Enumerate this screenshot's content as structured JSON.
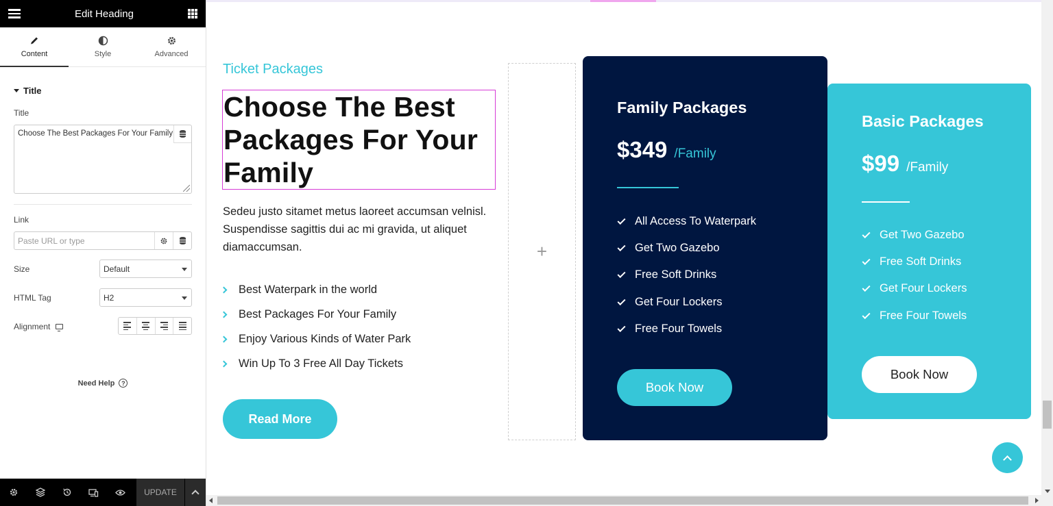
{
  "panel": {
    "header_title": "Edit Heading",
    "tabs": [
      {
        "label": "Content",
        "icon": "pencil-icon"
      },
      {
        "label": "Style",
        "icon": "half-circle-icon"
      },
      {
        "label": "Advanced",
        "icon": "gear-icon"
      }
    ],
    "active_tab": "Content",
    "section_title": "Title",
    "title_label": "Title",
    "title_value": "Choose The Best Packages For Your Family",
    "link_label": "Link",
    "link_placeholder": "Paste URL or type",
    "size_label": "Size",
    "size_value": "Default",
    "html_tag_label": "HTML Tag",
    "html_tag_value": "H2",
    "alignment_label": "Alignment",
    "need_help": "Need Help",
    "footer": {
      "update_label": "UPDATE"
    }
  },
  "page": {
    "subtitle": "Ticket Packages",
    "heading_lines": [
      "Choose The Best",
      "Packages For Your",
      "Family"
    ],
    "description": "Sedeu justo sitamet metus laoreet accumsan velnisl. Suspendisse sagittis dui ac mi gravida, ut aliquet diamaccumsan.",
    "features": [
      "Best Waterpark in the world",
      "Best Packages For Your Family",
      "Enjoy Various Kinds of Water Park",
      "Win Up To 3 Free All Day Tickets"
    ],
    "read_more": "Read More",
    "add_icon": "+"
  },
  "cards": [
    {
      "title": "Family Packages",
      "price": "$349",
      "per": "/Family",
      "items": [
        "All Access To Waterpark",
        "Get Two Gazebo",
        "Free Soft Drinks",
        "Get Four Lockers",
        "Free Four Towels"
      ],
      "button": "Book Now"
    },
    {
      "title": "Basic Packages",
      "price": "$99",
      "per": "/Family",
      "items": [
        "Get Two Gazebo",
        "Free Soft Drinks",
        "Get Four Lockers",
        "Free Four Towels"
      ],
      "button": "Book Now"
    }
  ],
  "colors": {
    "accent": "#36c6d8",
    "navy": "#001640",
    "selection": "#d63bd6"
  }
}
